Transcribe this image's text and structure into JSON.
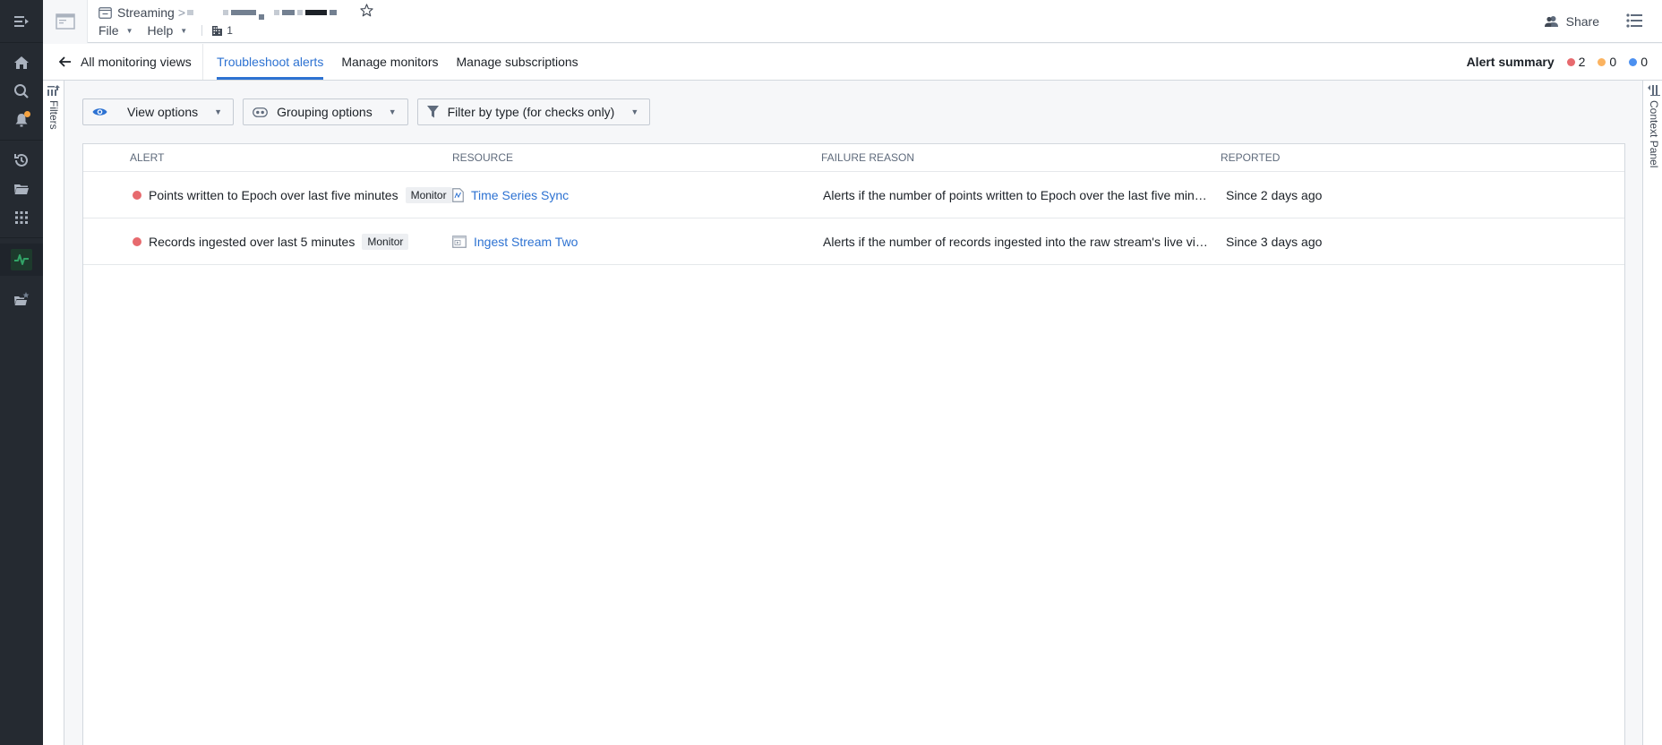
{
  "header": {
    "breadcrumb_root": "Streaming",
    "breadcrumb_sep": ">",
    "menus": [
      {
        "label": "File"
      },
      {
        "label": "Help"
      }
    ],
    "org_count": "1",
    "share_label": "Share"
  },
  "subheader": {
    "back_label": "All monitoring views",
    "tabs": [
      {
        "label": "Troubleshoot alerts",
        "active": true
      },
      {
        "label": "Manage monitors",
        "active": false
      },
      {
        "label": "Manage subscriptions",
        "active": false
      }
    ],
    "alert_summary": {
      "label": "Alert summary",
      "counts": [
        {
          "severity": "critical",
          "color": "#e76a6e",
          "value": "2"
        },
        {
          "severity": "warning",
          "color": "#fbb360",
          "value": "0"
        },
        {
          "severity": "info",
          "color": "#4c90f0",
          "value": "0"
        }
      ]
    }
  },
  "side_panels": {
    "filters_label": "Filters",
    "context_label": "Context Panel"
  },
  "toolbar": {
    "view_options": "View options",
    "grouping_options": "Grouping options",
    "filter_type": "Filter by type (for checks only)"
  },
  "table": {
    "columns": [
      "ALERT",
      "RESOURCE",
      "FAILURE REASON",
      "REPORTED"
    ],
    "rows": [
      {
        "alert": "Points written to Epoch over last five minutes",
        "tag": "Monitor",
        "resource": "Time Series Sync",
        "resource_icon": "time-series-file-icon",
        "failure_reason": "Alerts if the number of points written to Epoch over the last five minute …",
        "reported": "Since 2 days ago"
      },
      {
        "alert": "Records ingested over last 5 minutes",
        "tag": "Monitor",
        "resource": "Ingest Stream Two",
        "resource_icon": "stream-icon",
        "failure_reason": "Alerts if the number of records ingested into the raw stream's live view o…",
        "reported": "Since 3 days ago"
      }
    ]
  },
  "colors": {
    "accent": "#2d72d2",
    "rail_bg": "#252a31",
    "active_green": "#32a467",
    "critical": "#e76a6e"
  }
}
